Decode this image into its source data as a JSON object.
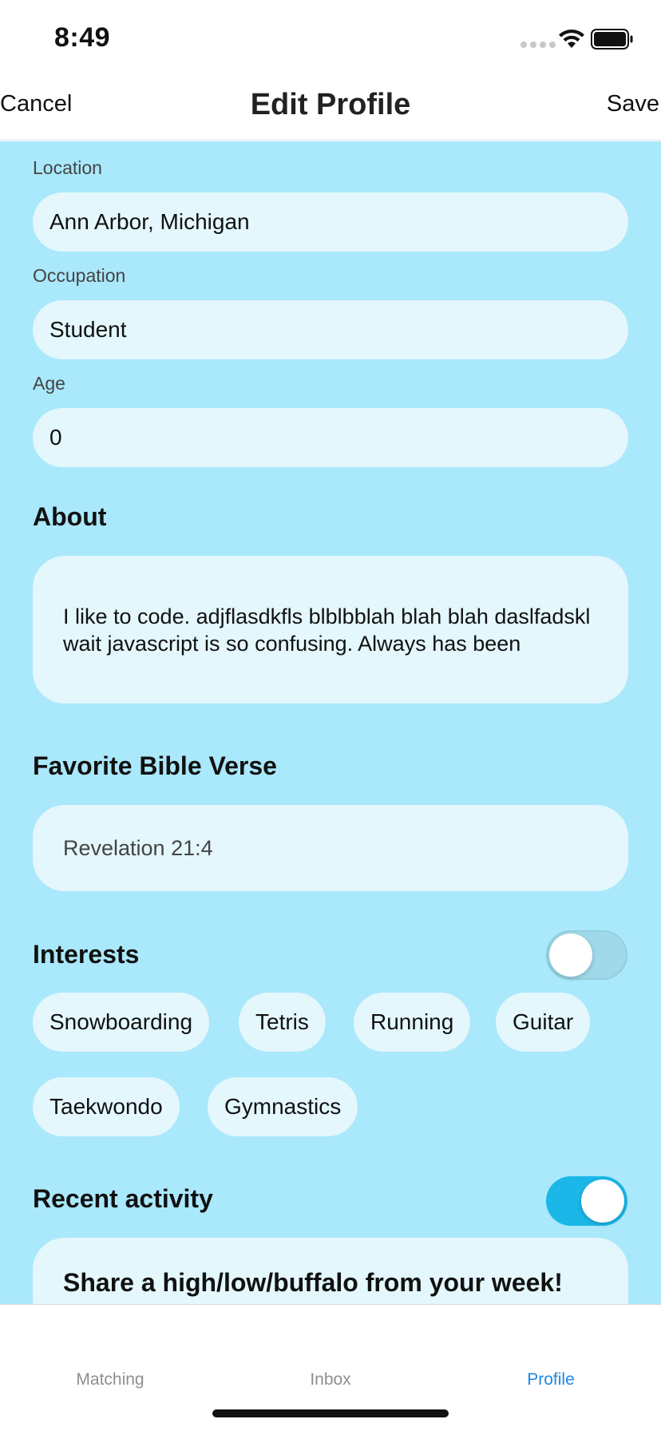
{
  "status_bar": {
    "time": "8:49"
  },
  "nav": {
    "cancel": "Cancel",
    "title": "Edit Profile",
    "save": "Save"
  },
  "fields": {
    "location": {
      "label": "Location",
      "value": "Ann Arbor, Michigan"
    },
    "occupation": {
      "label": "Occupation",
      "value": "Student"
    },
    "age": {
      "label": "Age",
      "value": "0"
    }
  },
  "about": {
    "title": "About",
    "text": "I like to code. adjflasdkfls blblbblah blah blah daslfadskl wait javascript is so confusing. Always has been"
  },
  "bible_verse": {
    "title": "Favorite Bible Verse",
    "value": "Revelation 21:4"
  },
  "interests": {
    "title": "Interests",
    "toggle_on": false,
    "items": [
      "Snowboarding",
      "Tetris",
      "Running",
      "Guitar",
      "Taekwondo",
      "Gymnastics"
    ]
  },
  "recent_activity": {
    "title": "Recent activity",
    "toggle_on": true,
    "card_title": "Share a high/low/buffalo from your week!"
  },
  "tabs": [
    {
      "label": "Matching",
      "active": false
    },
    {
      "label": "Inbox",
      "active": false
    },
    {
      "label": "Profile",
      "active": true
    }
  ],
  "colors": {
    "background": "#aae8fb",
    "field": "#e3f7fd",
    "accent": "#1ab7e8",
    "tab_active": "#1e88e5",
    "tab_inactive": "#8e8e93"
  },
  "icons": [
    "wifi-icon",
    "battery-icon",
    "signal-dots-icon"
  ]
}
